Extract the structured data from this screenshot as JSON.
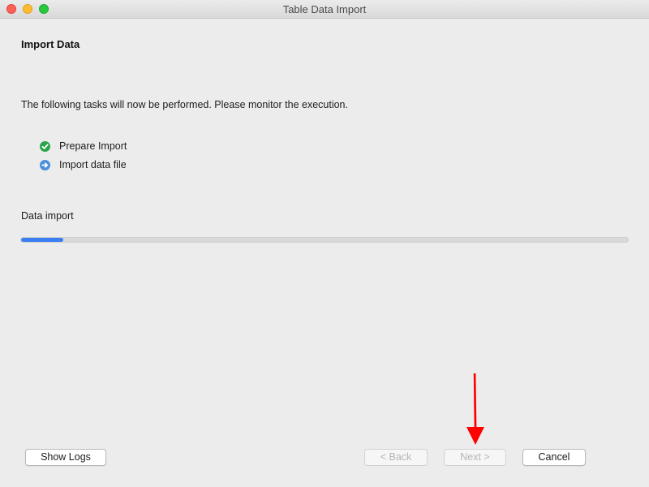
{
  "window": {
    "title": "Table Data Import"
  },
  "page": {
    "heading": "Import Data",
    "description": "The following tasks will now be performed. Please monitor the execution."
  },
  "tasks": [
    {
      "label": "Prepare Import",
      "status": "done",
      "icon": "check-circle-icon",
      "color": "#2aa54a"
    },
    {
      "label": "Import data file",
      "status": "running",
      "icon": "arrow-right-circle-icon",
      "color": "#4a90d9"
    }
  ],
  "progress": {
    "label": "Data import",
    "fraction": 0.07,
    "color": "#3b7ff2"
  },
  "buttons": {
    "show_logs": "Show Logs",
    "back": "< Back",
    "next": "Next >",
    "cancel": "Cancel"
  },
  "annotation": {
    "arrow_color": "#ff0000"
  }
}
